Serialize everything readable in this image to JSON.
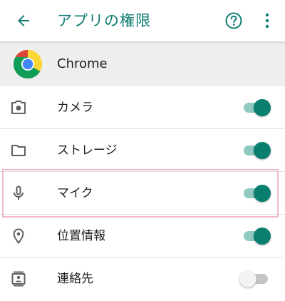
{
  "header": {
    "title": "アプリの権限",
    "back_icon": "arrow-left-icon",
    "help_icon": "help-circle-icon",
    "more_icon": "more-vert-icon"
  },
  "app": {
    "name": "Chrome",
    "icon": "chrome-logo-icon"
  },
  "permissions": [
    {
      "label": "カメラ",
      "icon": "camera-icon",
      "enabled": true
    },
    {
      "label": "ストレージ",
      "icon": "folder-icon",
      "enabled": true
    },
    {
      "label": "マイク",
      "icon": "microphone-icon",
      "enabled": true
    },
    {
      "label": "位置情報",
      "icon": "location-icon",
      "enabled": true
    },
    {
      "label": "連絡先",
      "icon": "contacts-icon",
      "enabled": false
    }
  ],
  "colors": {
    "accent": "#117c74",
    "switch_on_thumb": "#0a7f70",
    "switch_on_track": "#8fc9c2",
    "highlight_border": "#f4b7d2"
  }
}
